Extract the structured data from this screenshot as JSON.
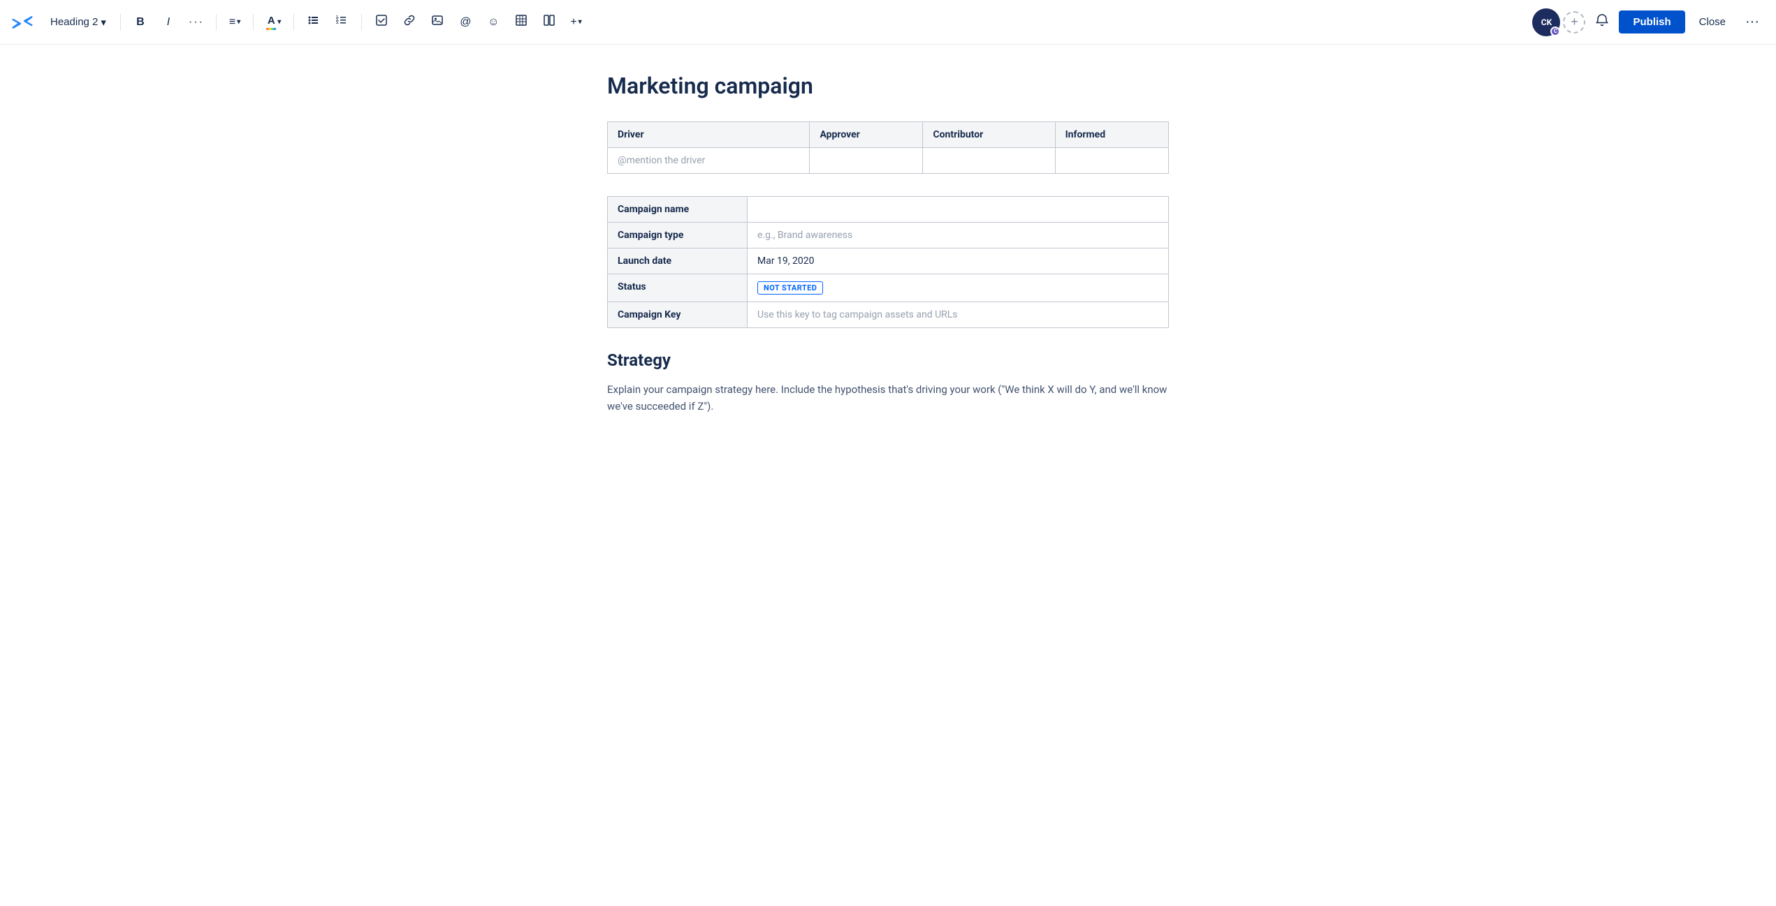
{
  "toolbar": {
    "logo_label": "Confluence",
    "heading_label": "Heading 2",
    "bold_label": "B",
    "italic_label": "I",
    "more_format_label": "···",
    "align_label": "≡",
    "align_arrow": "▾",
    "color_label": "A",
    "bullet_label": "☰",
    "ordered_label": "☰",
    "task_label": "☑",
    "link_label": "🔗",
    "image_label": "🖼",
    "mention_label": "@",
    "emoji_label": "☺",
    "table_label": "⊞",
    "layout_label": "⊟",
    "insert_label": "+",
    "add_label": "+",
    "avatar_initials": "CK",
    "avatar_badge": "C",
    "publish_label": "Publish",
    "close_label": "Close",
    "more_label": "···"
  },
  "page": {
    "title": "Marketing campaign"
  },
  "roles_table": {
    "headers": [
      "Driver",
      "Approver",
      "Contributor",
      "Informed"
    ],
    "row": {
      "driver": "@mention the driver",
      "approver": "",
      "contributor": "",
      "informed": ""
    }
  },
  "details_table": {
    "rows": [
      {
        "label": "Campaign name",
        "value": "",
        "placeholder": false,
        "is_status": false
      },
      {
        "label": "Campaign type",
        "value": "e.g., Brand awareness",
        "placeholder": true,
        "is_status": false
      },
      {
        "label": "Launch date",
        "value": "Mar 19, 2020",
        "placeholder": false,
        "is_status": false
      },
      {
        "label": "Status",
        "value": "NOT STARTED",
        "placeholder": false,
        "is_status": true
      },
      {
        "label": "Campaign Key",
        "value": "Use this key to tag campaign assets and URLs",
        "placeholder": true,
        "is_status": false
      }
    ]
  },
  "strategy": {
    "heading": "Strategy",
    "body": "Explain your campaign strategy here. Include the hypothesis that's driving your work (\"We think X will do Y, and we'll know we've succeeded if Z\")."
  }
}
